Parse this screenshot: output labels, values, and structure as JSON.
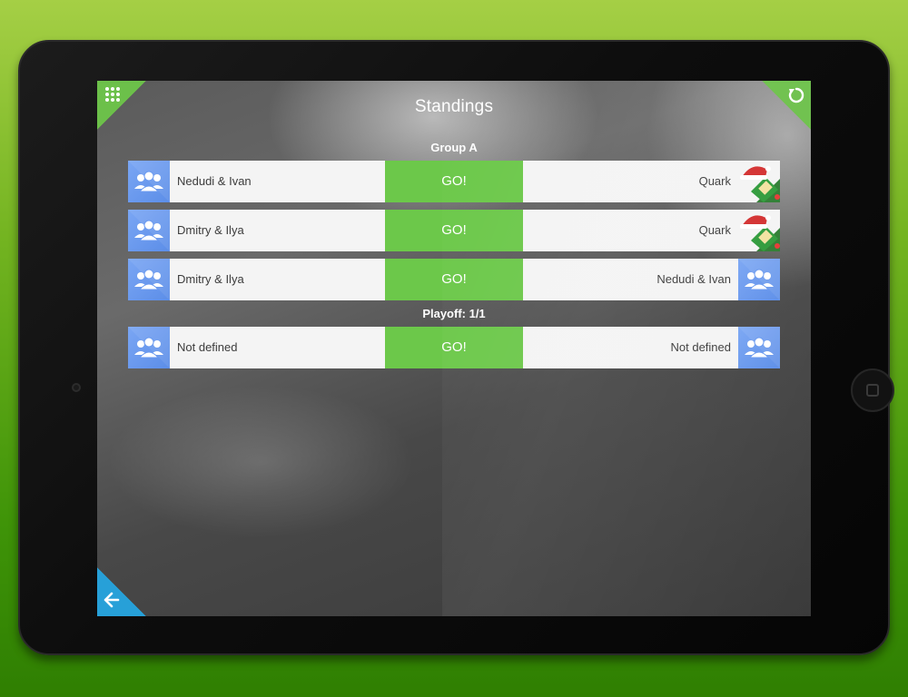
{
  "screen": {
    "title": "Standings"
  },
  "groups": [
    {
      "label": "Group A",
      "matches": [
        {
          "left_team": "Nedudi & Ivan",
          "left_avatar": "team-avatar",
          "go_label": "GO!",
          "right_team": "Quark",
          "right_avatar": "santa-gift-avatar"
        },
        {
          "left_team": "Dmitry & Ilya",
          "left_avatar": "team-avatar",
          "go_label": "GO!",
          "right_team": "Quark",
          "right_avatar": "santa-gift-avatar"
        },
        {
          "left_team": "Dmitry & Ilya",
          "left_avatar": "team-avatar",
          "go_label": "GO!",
          "right_team": "Nedudi & Ivan",
          "right_avatar": "team-avatar"
        }
      ]
    },
    {
      "label": "Playoff: 1/1",
      "matches": [
        {
          "left_team": "Not defined",
          "left_avatar": "team-avatar",
          "go_label": "GO!",
          "right_team": "Not defined",
          "right_avatar": "team-avatar"
        }
      ]
    }
  ],
  "corners": {
    "top_left_icon": "grid-menu-icon",
    "top_right_icon": "refresh-icon",
    "bottom_left_icon": "back-arrow-icon"
  },
  "colors": {
    "background_green": "#72b320",
    "go_green": "#6cc84a",
    "corner_green": "#6cc04a",
    "corner_blue": "#27a0d8",
    "avatar_blue": "#6a9af0",
    "row_bg": "#f4f4f4"
  }
}
